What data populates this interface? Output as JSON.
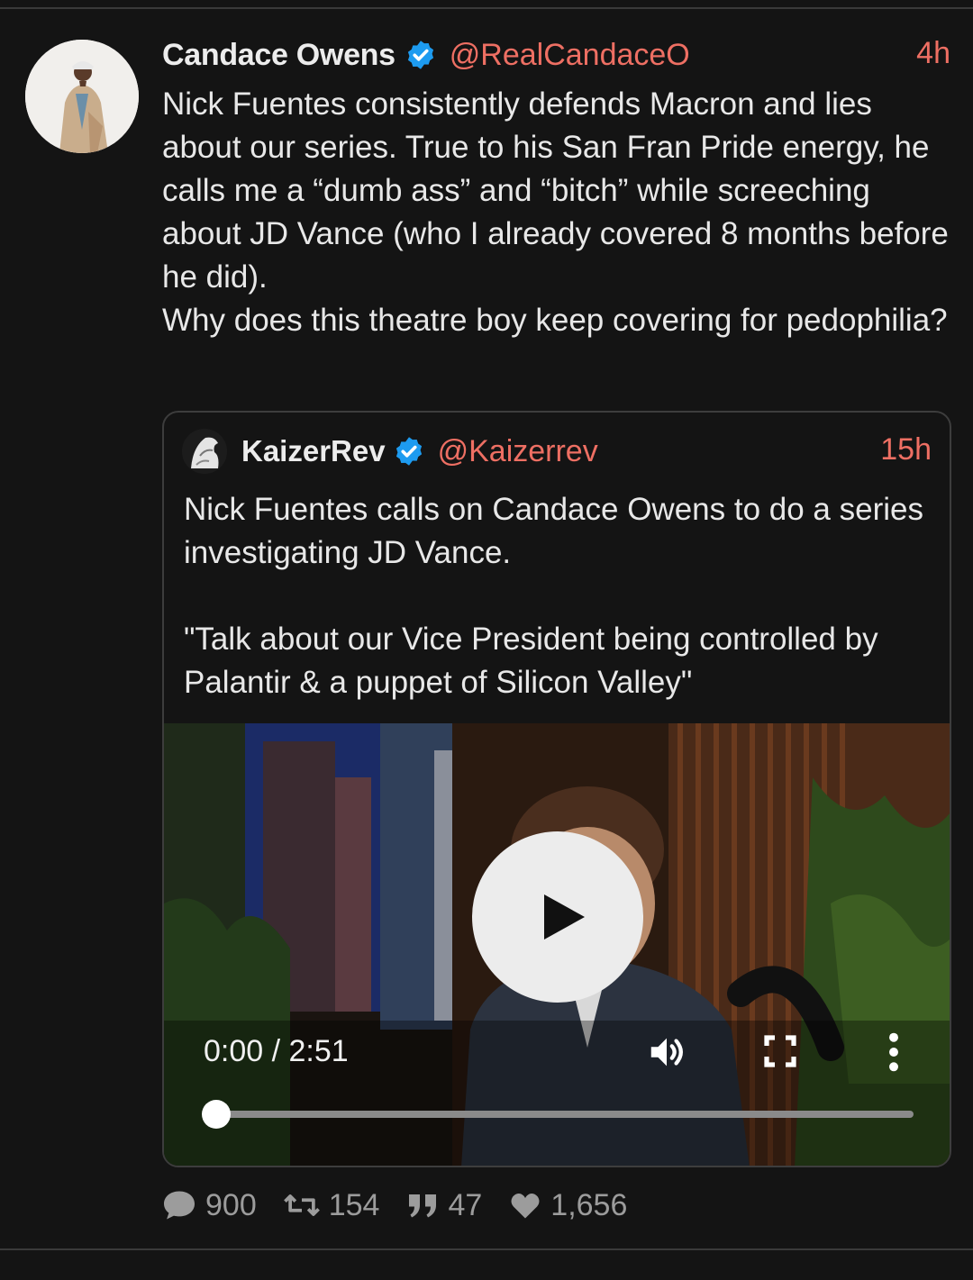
{
  "post": {
    "author_name": "Candace Owens",
    "handle": "@RealCandaceO",
    "time": "4h",
    "text": "Nick Fuentes consistently defends Macron and lies about our series. True to his San Fran Pride energy, he calls me a “dumb ass” and “bitch” while screeching about JD Vance (who I already covered 8 months before he did).\nWhy does this theatre boy keep covering for pedophilia?"
  },
  "quote": {
    "author_name": "KaizerRev",
    "handle": "@Kaizerrev",
    "time": "15h",
    "text": "Nick Fuentes calls on Candace Owens to do a series investigating JD Vance.\n\n\"Talk about our Vice President being controlled by Palantir & a puppet of Silicon Valley\""
  },
  "video": {
    "time_display": "0:00 / 2:51",
    "progress": 0
  },
  "actions": {
    "replies": "900",
    "reposts": "154",
    "quotes": "47",
    "likes": "1,656"
  },
  "icons": {
    "verified": "verified-badge-icon",
    "play": "play-icon",
    "volume": "volume-icon",
    "fullscreen": "fullscreen-icon",
    "more": "more-vertical-icon",
    "reply": "comment-icon",
    "repost": "repost-icon",
    "quote": "quote-icon",
    "like": "heart-icon"
  },
  "colors": {
    "background": "#141414",
    "handle": "#ee6f63",
    "verified": "#1d9bf0",
    "muted": "#9c9c9c"
  }
}
